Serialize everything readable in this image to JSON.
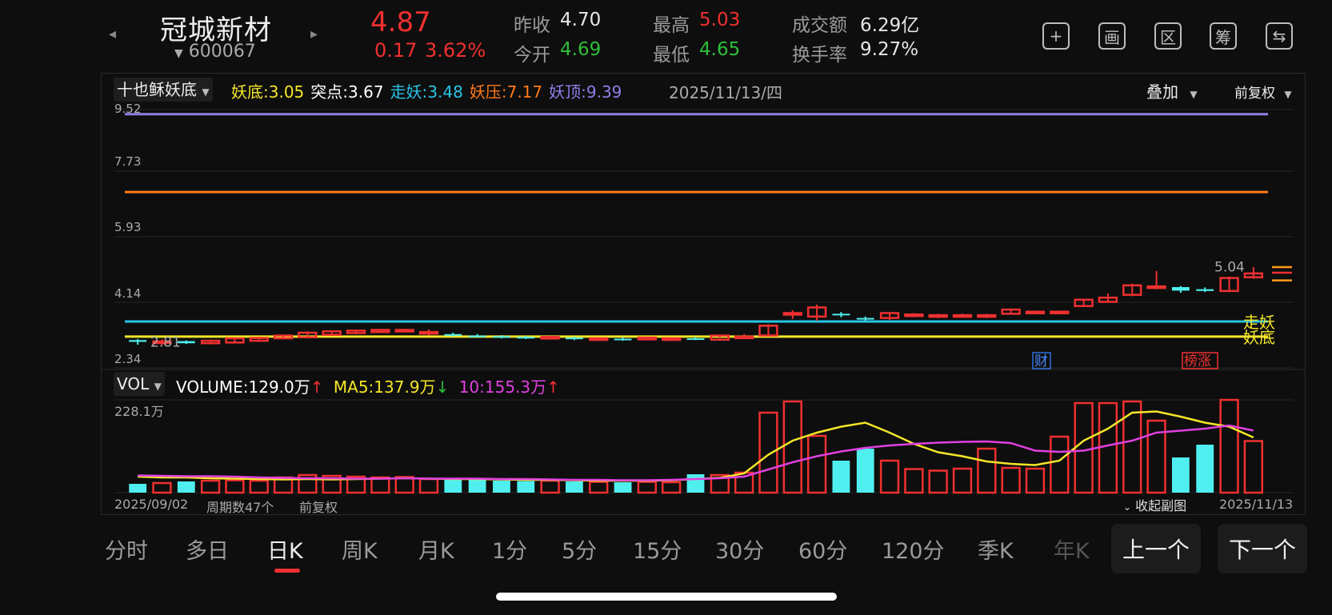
{
  "header": {
    "name": "冠城新材",
    "code": "600067",
    "price": "4.87",
    "change": "0.17",
    "change_pct": "3.62%",
    "stats": [
      {
        "label": "昨收",
        "value": "4.70",
        "color": "#e6e6e6"
      },
      {
        "label": "今开",
        "value": "4.69",
        "color": "#2fbf3a"
      },
      {
        "label": "最高",
        "value": "5.03",
        "color": "#f03030"
      },
      {
        "label": "最低",
        "value": "4.65",
        "color": "#2fbf3a"
      },
      {
        "label": "成交额",
        "value": "6.29亿",
        "color": "#e6e6e6"
      },
      {
        "label": "换手率",
        "value": "9.27%",
        "color": "#e6e6e6"
      }
    ],
    "icons": [
      "add-icon",
      "draw-icon",
      "range-icon",
      "chip-icon",
      "switch-screen-icon"
    ],
    "icon_glyphs": [
      "+",
      "画",
      "区",
      "筹",
      "⇆"
    ]
  },
  "main_chart": {
    "indicator": "十也稣妖底",
    "legend": [
      {
        "label": "妖底:",
        "value": "3.05",
        "color": "#f5e62a"
      },
      {
        "label": "突点:",
        "value": "3.67",
        "color": "#ffffff"
      },
      {
        "label": "走妖:",
        "value": "3.48",
        "color": "#29c5e6"
      },
      {
        "label": "妖压:",
        "value": "7.17",
        "color": "#ff7a1a"
      },
      {
        "label": "妖顶:",
        "value": "9.39",
        "color": "#8f7ee6"
      }
    ],
    "date": "2025/11/13/四",
    "overlay": "叠加",
    "adjust": "前复权",
    "y_ticks": [
      "9.52",
      "7.73",
      "5.93",
      "4.14",
      "2.34"
    ],
    "low_label": "2.81",
    "high_label": "5.04",
    "zone_labels": [
      "走妖",
      "妖底"
    ],
    "badges": [
      "财",
      "榜涨"
    ]
  },
  "volume_chart": {
    "indicator": "VOL",
    "volume_label": "VOLUME:",
    "volume_value": "129.0万",
    "ma5_label": "MA5:",
    "ma5_value": "137.9万",
    "ma10_label": "10:",
    "ma10_value": "155.3万",
    "max_label": "228.1万",
    "start_date": "2025/09/02",
    "period_count": "周期数47个",
    "adjust": "前复权",
    "collapse": "收起副图",
    "end_date": "2025/11/13"
  },
  "tabs": [
    "分时",
    "多日",
    "日K",
    "周K",
    "月K",
    "1分",
    "5分",
    "15分",
    "30分",
    "60分",
    "120分",
    "季K",
    "年K"
  ],
  "active_tab": 2,
  "prev_button": "上一个",
  "next_button": "下一个",
  "chart_data": {
    "type": "candlestick",
    "y_range": [
      2.34,
      9.52
    ],
    "hlines": [
      {
        "name": "妖顶",
        "value": 9.39,
        "color": "#8f7ee6"
      },
      {
        "name": "妖压",
        "value": 7.17,
        "color": "#ff7a1a"
      },
      {
        "name": "走妖",
        "value": 3.48,
        "color": "#29c5e6"
      },
      {
        "name": "妖底",
        "value": 3.05,
        "color": "#f5e62a"
      }
    ],
    "candles": [
      [
        2.95,
        2.9,
        2.98,
        2.82
      ],
      [
        2.88,
        2.91,
        2.97,
        2.81
      ],
      [
        2.92,
        2.86,
        2.94,
        2.84
      ],
      [
        2.86,
        2.93,
        2.96,
        2.84
      ],
      [
        2.88,
        3.0,
        3.02,
        2.86
      ],
      [
        2.93,
        3.01,
        3.04,
        2.9
      ],
      [
        3.0,
        3.08,
        3.11,
        2.98
      ],
      [
        3.03,
        3.16,
        3.2,
        3.01
      ],
      [
        3.1,
        3.2,
        3.22,
        3.08
      ],
      [
        3.15,
        3.22,
        3.24,
        3.12
      ],
      [
        3.18,
        3.24,
        3.26,
        3.16
      ],
      [
        3.22,
        3.24,
        3.27,
        3.2
      ],
      [
        3.16,
        3.18,
        3.25,
        3.08
      ],
      [
        3.12,
        3.1,
        3.16,
        3.05
      ],
      [
        3.08,
        3.06,
        3.12,
        3.02
      ],
      [
        3.06,
        3.05,
        3.09,
        3.0
      ],
      [
        3.04,
        3.01,
        3.07,
        2.98
      ],
      [
        3.0,
        3.04,
        3.06,
        2.96
      ],
      [
        3.02,
        2.99,
        3.05,
        2.95
      ],
      [
        2.98,
        3.0,
        3.03,
        2.94
      ],
      [
        2.99,
        2.97,
        3.03,
        2.93
      ],
      [
        2.97,
        3.02,
        3.05,
        2.95
      ],
      [
        3.0,
        3.0,
        3.03,
        2.96
      ],
      [
        3.0,
        2.99,
        3.04,
        2.95
      ],
      [
        2.96,
        3.08,
        3.1,
        2.94
      ],
      [
        3.02,
        3.05,
        3.12,
        3.0
      ],
      [
        3.08,
        3.36,
        3.4,
        3.06
      ],
      [
        3.68,
        3.72,
        3.8,
        3.55
      ],
      [
        3.62,
        3.88,
        3.96,
        3.5
      ],
      [
        3.7,
        3.68,
        3.75,
        3.6
      ],
      [
        3.58,
        3.55,
        3.62,
        3.5
      ],
      [
        3.58,
        3.72,
        3.75,
        3.52
      ],
      [
        3.66,
        3.68,
        3.72,
        3.6
      ],
      [
        3.64,
        3.66,
        3.7,
        3.58
      ],
      [
        3.65,
        3.66,
        3.7,
        3.6
      ],
      [
        3.63,
        3.66,
        3.7,
        3.58
      ],
      [
        3.7,
        3.82,
        3.84,
        3.68
      ],
      [
        3.74,
        3.76,
        3.79,
        3.7
      ],
      [
        3.75,
        3.76,
        3.79,
        3.7
      ],
      [
        3.92,
        4.1,
        4.12,
        3.9
      ],
      [
        4.04,
        4.16,
        4.28,
        4.02
      ],
      [
        4.24,
        4.51,
        4.56,
        4.2
      ],
      [
        4.45,
        4.48,
        4.92,
        4.4
      ],
      [
        4.46,
        4.36,
        4.49,
        4.3
      ],
      [
        4.4,
        4.35,
        4.45,
        4.32
      ],
      [
        4.35,
        4.72,
        4.76,
        4.32
      ],
      [
        4.74,
        4.85,
        5.03,
        4.7
      ]
    ],
    "volumes": [
      22,
      24,
      28,
      30,
      31,
      30,
      38,
      44,
      42,
      40,
      38,
      39,
      34,
      32,
      32,
      30,
      29,
      30,
      28,
      27,
      26,
      27,
      26,
      46,
      44,
      50,
      200,
      228,
      142,
      80,
      110,
      80,
      59,
      55,
      60,
      110,
      62,
      60,
      140,
      224,
      224,
      228,
      180,
      88,
      120,
      232,
      129
    ],
    "ma5": [
      40,
      38,
      38,
      36,
      35,
      34,
      33,
      34,
      33,
      34,
      35,
      36,
      35,
      34,
      34,
      33,
      32,
      32,
      31,
      30,
      30,
      30,
      31,
      34,
      37,
      48,
      95,
      130,
      150,
      165,
      175,
      150,
      122,
      101,
      91,
      78,
      72,
      69,
      80,
      130,
      160,
      200,
      203,
      190,
      175,
      165,
      137.9
    ],
    "ma10": [
      43,
      42,
      41,
      41,
      40,
      38,
      37,
      36,
      36,
      35,
      35,
      36,
      35,
      35,
      35,
      34,
      34,
      33,
      32,
      32,
      31,
      31,
      32,
      34,
      36,
      40,
      58,
      76,
      91,
      103,
      112,
      118,
      122,
      125,
      127,
      128,
      124,
      105,
      102,
      105,
      118,
      130,
      150,
      155,
      160,
      168,
      155.3
    ]
  }
}
